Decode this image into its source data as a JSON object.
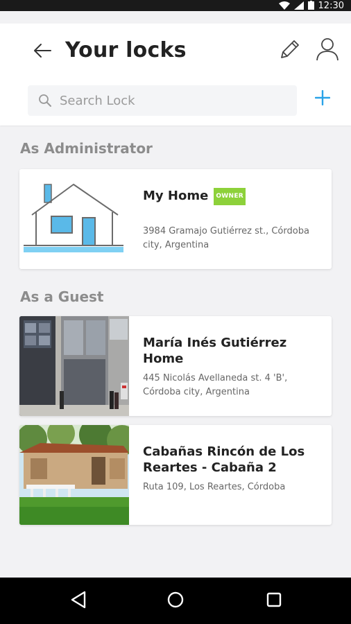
{
  "status_bar": {
    "time": "12:30"
  },
  "header": {
    "title": "Your locks",
    "search_placeholder": "Search Lock"
  },
  "sections": {
    "admin_label": "As Administrator",
    "guest_label": "As a Guest"
  },
  "admin_locks": [
    {
      "name": "My Home",
      "badge": "OWNER",
      "address": "3984 Gramajo Gutiérrez st., Córdoba city, Argentina"
    }
  ],
  "guest_locks": [
    {
      "name": "María Inés Gutiérrez Home",
      "address": "445 Nicolás Avellaneda st. 4 'B', Córdoba city, Argentina"
    },
    {
      "name": "Cabañas Rincón de Los Reartes - Cabaña 2",
      "address": "Ruta 109, Los Reartes, Córdoba"
    }
  ],
  "colors": {
    "accent": "#2aa3e8",
    "owner_badge": "#8dd13a",
    "house_line": "#6b6b6b",
    "house_fill": "#5ab9e8"
  },
  "icons": {
    "back": "arrow-left-icon",
    "edit": "pencil-icon",
    "profile": "user-icon",
    "search": "search-icon",
    "add": "plus-icon"
  }
}
